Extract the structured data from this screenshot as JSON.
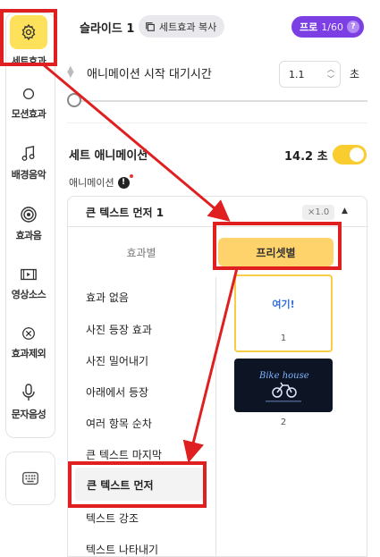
{
  "sidebar": {
    "items": [
      {
        "label": "세트효과",
        "icon": "gear-icon",
        "active": true
      },
      {
        "label": "모션효과",
        "icon": "circle-icon"
      },
      {
        "label": "배경음악",
        "icon": "music-note-icon"
      },
      {
        "label": "효과음",
        "icon": "target-icon"
      },
      {
        "label": "영상소스",
        "icon": "video-frame-icon"
      },
      {
        "label": "효과제외",
        "icon": "exclude-circle-icon"
      },
      {
        "label": "문자음성",
        "icon": "microphone-icon"
      }
    ],
    "bottom_icon": "keyboard-icon"
  },
  "header": {
    "slide_title": "슬라이드 1",
    "copy_button": "세트효과 복사",
    "pro_label": "프로",
    "pro_count": "1/60",
    "help": "?"
  },
  "delay": {
    "label": "애니메이션 시작 대기시간",
    "value": "1.1",
    "unit": "초",
    "slider_level": 0
  },
  "set_animation": {
    "label": "세트 애니메이션",
    "value": "14.2 초",
    "toggle_on": true
  },
  "animation": {
    "label": "애니메이션",
    "warn": "!",
    "selected": "큰 텍스트 먼저 1",
    "speed": "×1.0"
  },
  "tabs": {
    "effect": "효과별",
    "preset": "프리셋별"
  },
  "effects": [
    "효과 없음",
    "사진 등장 효과",
    "사진 밀어내기",
    "아래에서 등장",
    "여러 항목 순차",
    "큰 텍스트 마지막",
    "큰 텍스트 먼저",
    "텍스트 강조",
    "텍스트 나타내기"
  ],
  "presets": [
    {
      "number": "1",
      "text": "여기!"
    },
    {
      "number": "2",
      "text": "Bike house"
    }
  ],
  "colors": {
    "accent_yellow": "#fde15a",
    "preset_tab": "#ffd36b",
    "pro_purple": "#7b3fe4",
    "annotation_red": "#e02020"
  }
}
